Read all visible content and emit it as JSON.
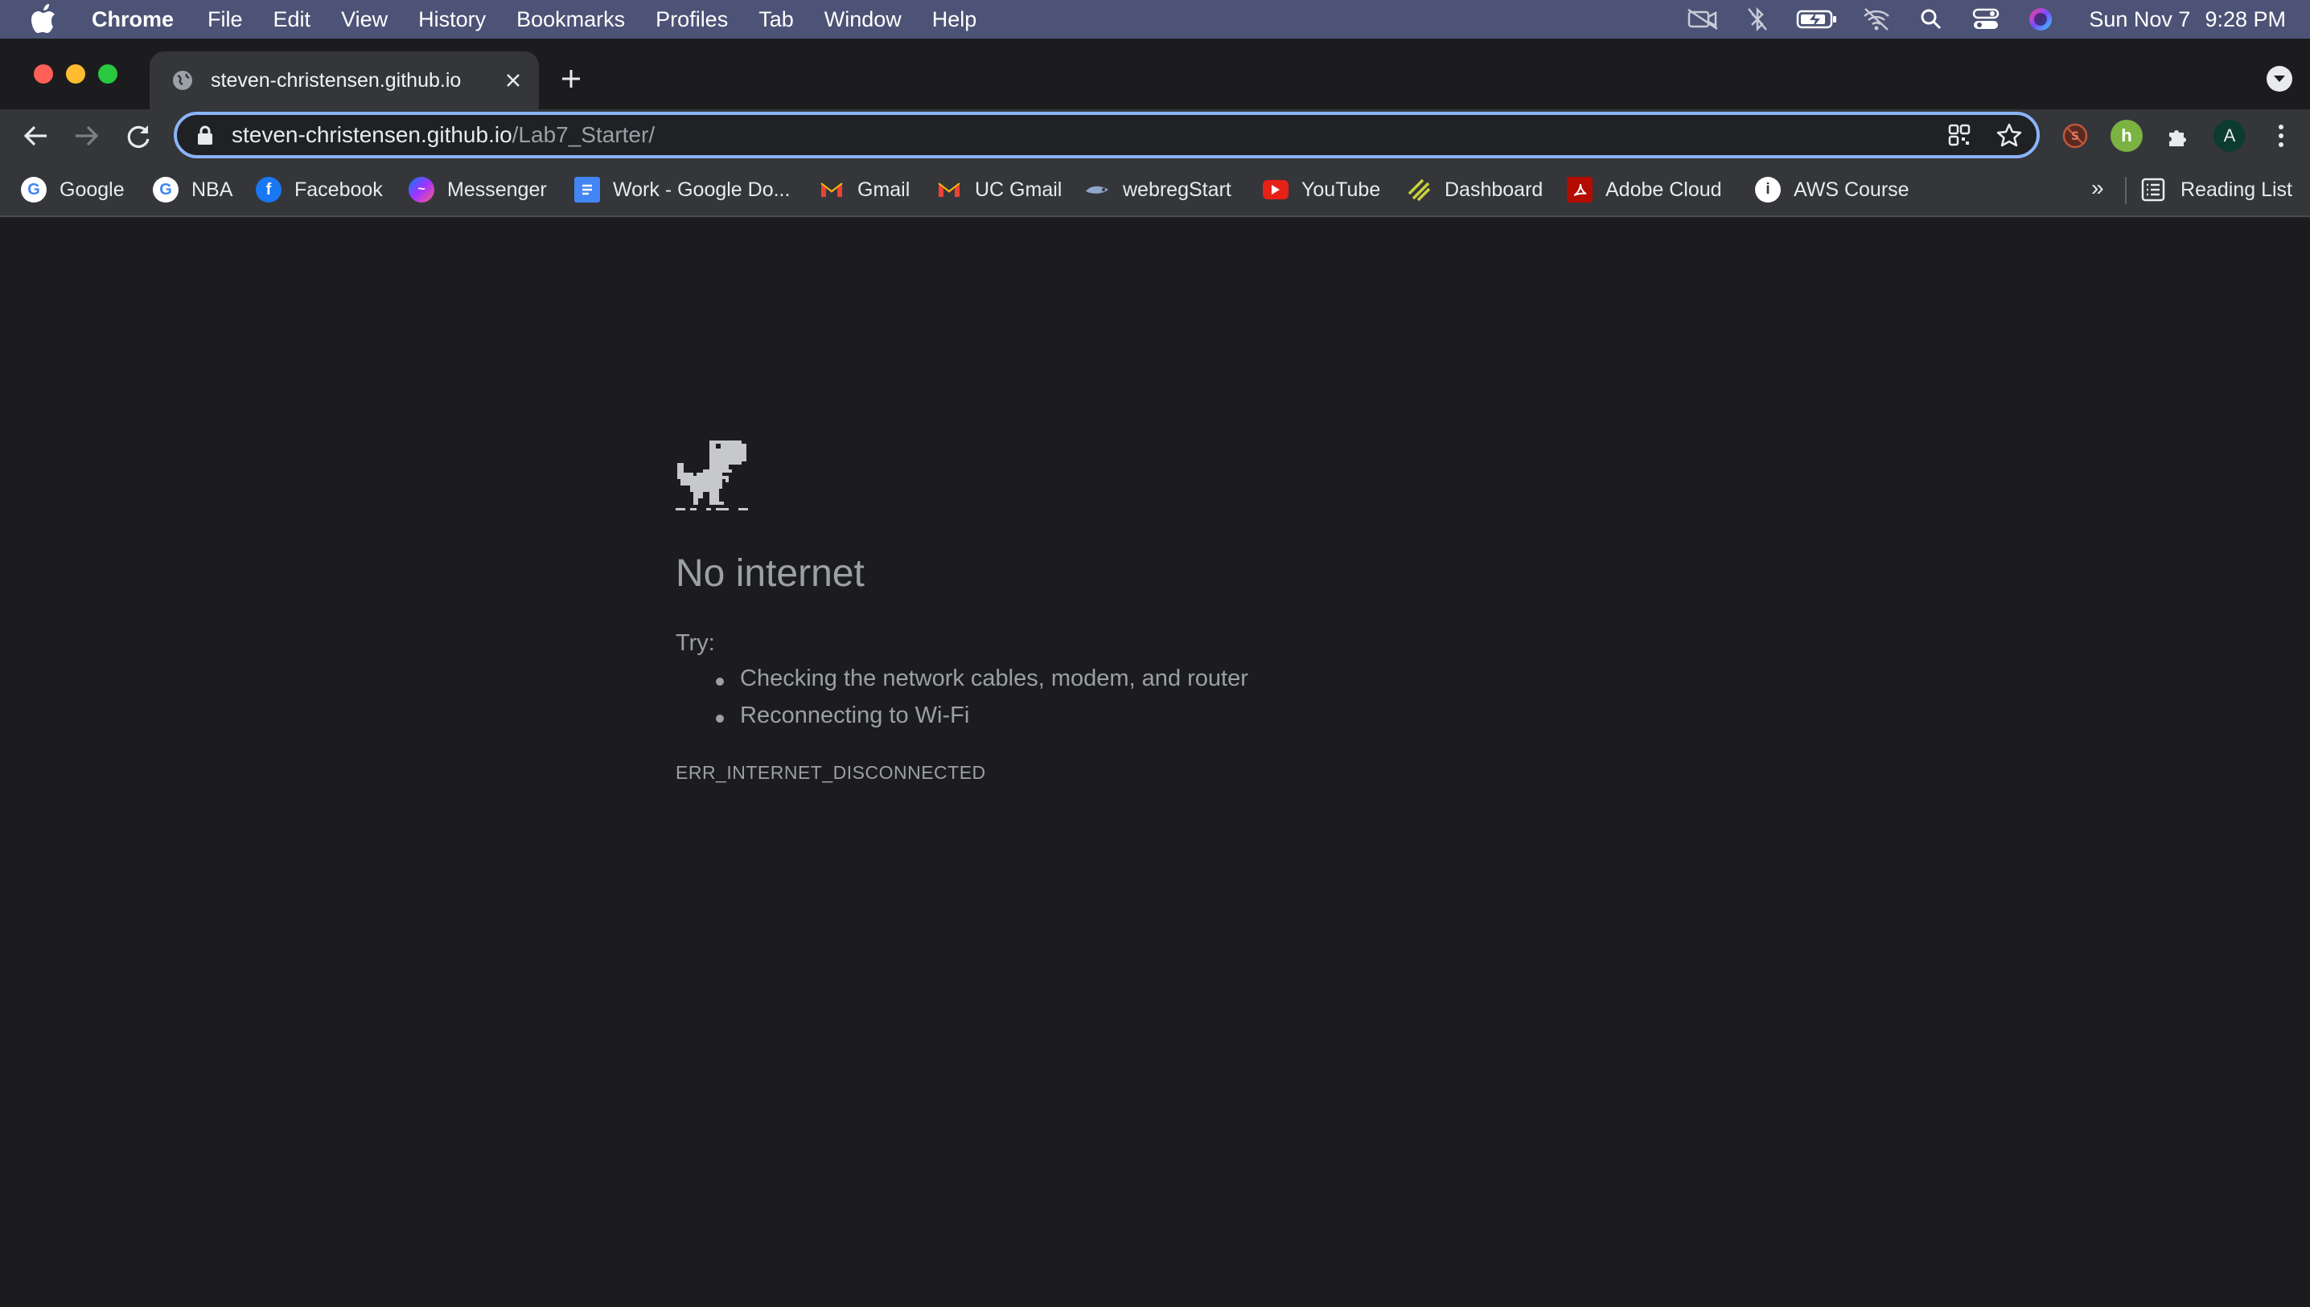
{
  "menubar": {
    "app_name": "Chrome",
    "items": [
      "File",
      "Edit",
      "View",
      "History",
      "Bookmarks",
      "Profiles",
      "Tab",
      "Window",
      "Help"
    ],
    "status_icons": [
      "camera-off-icon",
      "bluetooth-off-icon",
      "battery-charging-icon",
      "wifi-off-icon",
      "spotlight-icon",
      "control-center-icon",
      "siri-icon"
    ],
    "date": "Sun Nov 7",
    "time": "9:28 PM"
  },
  "tab": {
    "title": "steven-christensen.github.io"
  },
  "omnibox": {
    "host": "steven-christensen.github.io",
    "path": "/Lab7_Starter/"
  },
  "profile": {
    "initial": "A"
  },
  "bookmarks": {
    "items": [
      {
        "label": "Google",
        "icon": "google-icon"
      },
      {
        "label": "NBA",
        "icon": "google-icon"
      },
      {
        "label": "Facebook",
        "icon": "facebook-icon"
      },
      {
        "label": "Messenger",
        "icon": "messenger-icon"
      },
      {
        "label": "Work - Google Do...",
        "icon": "google-docs-icon"
      },
      {
        "label": "Gmail",
        "icon": "gmail-icon"
      },
      {
        "label": "UC Gmail",
        "icon": "gmail-icon"
      },
      {
        "label": "webregStart",
        "icon": "webreg-icon"
      },
      {
        "label": "YouTube",
        "icon": "youtube-icon"
      },
      {
        "label": "Dashboard",
        "icon": "dashboard-icon"
      },
      {
        "label": "Adobe Cloud",
        "icon": "adobe-icon"
      },
      {
        "label": "AWS Course",
        "icon": "aws-course-icon"
      }
    ],
    "more": "»",
    "reading_list": "Reading List"
  },
  "error_page": {
    "title": "No internet",
    "try_label": "Try:",
    "suggestions": [
      "Checking the network cables, modem, and router",
      "Reconnecting to Wi-Fi"
    ],
    "code": "ERR_INTERNET_DISCONNECTED"
  },
  "colors": {
    "menubar_bg": "#4d5376",
    "focus_ring": "#8ab4f8",
    "page_bg": "#1c1c1e",
    "muted_text": "#9aa0a6"
  }
}
